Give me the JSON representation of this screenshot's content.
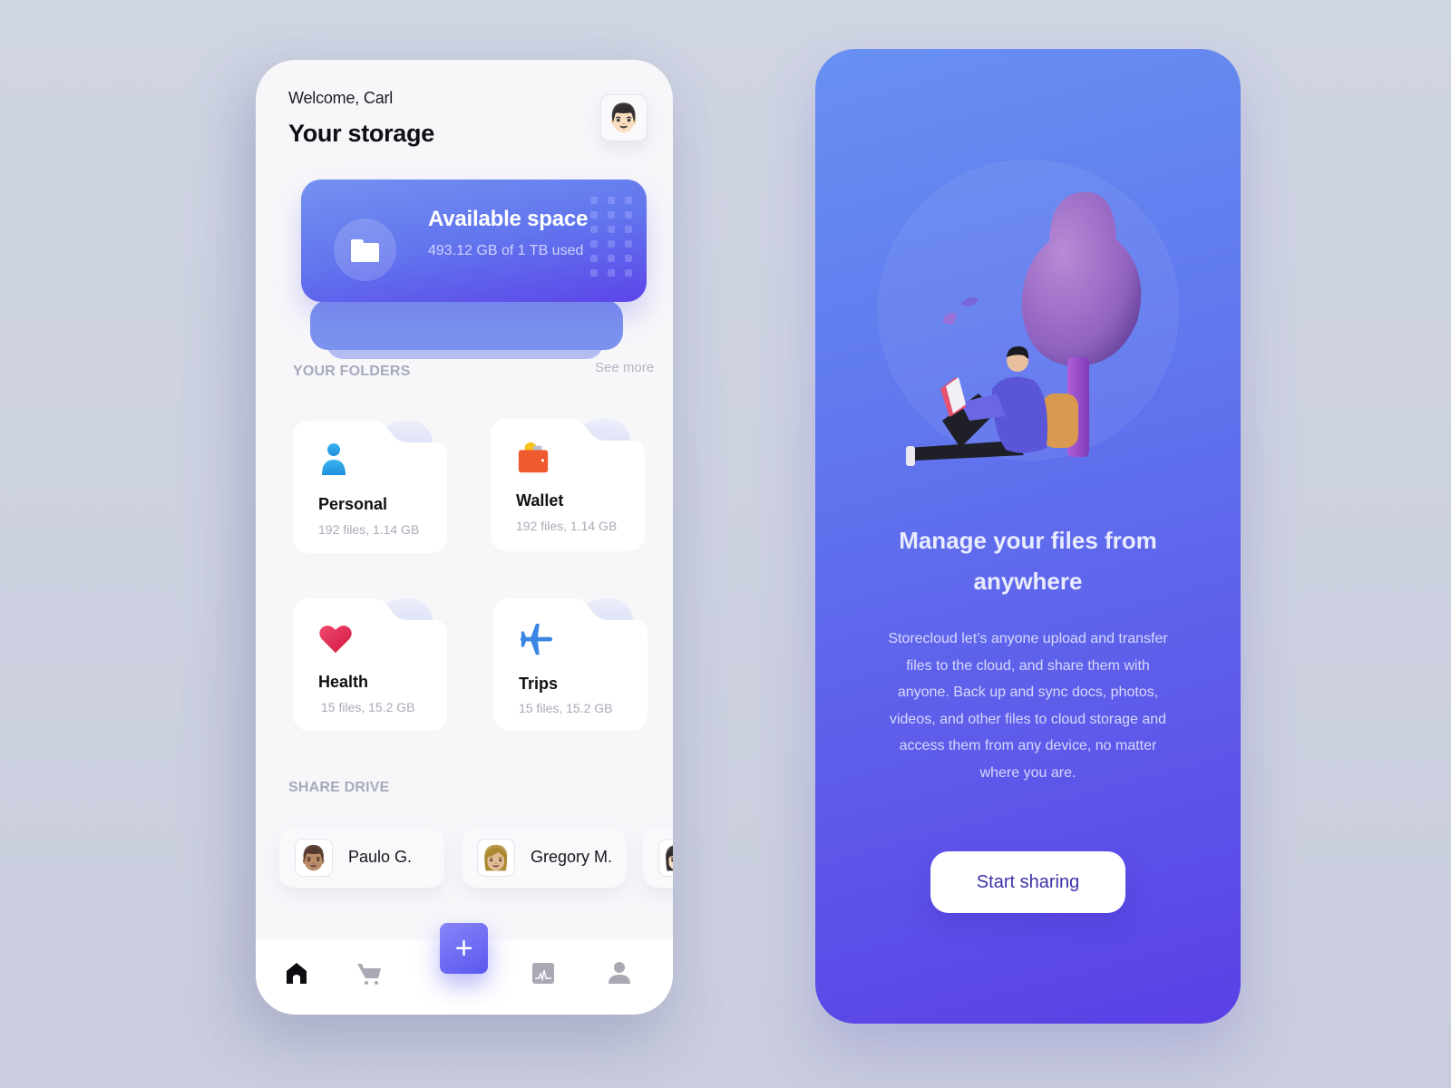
{
  "app": {
    "welcome": "Welcome, Carl",
    "title": "Your storage",
    "user_avatar": "man-mustache-emoji",
    "user_avatar_glyph": "👨🏻"
  },
  "storage": {
    "title": "Available space",
    "usage": "493.12 GB of 1 TB used",
    "used_gb": 493.12,
    "total_tb": 1,
    "icon": "folder-icon"
  },
  "folders": {
    "heading": "YOUR FOLDERS",
    "see_more": "See more",
    "items": [
      {
        "name": "Personal",
        "meta": "192 files, 1.14 GB",
        "icon": "person-icon",
        "color": "#2aa3e6"
      },
      {
        "name": "Wallet",
        "meta": "192 files, 1.14 GB",
        "icon": "wallet-icon",
        "color": "#f0582e"
      },
      {
        "name": "Health",
        "meta": "15 files, 15.2 GB",
        "icon": "heart-icon",
        "color": "#e0264f"
      },
      {
        "name": "Trips",
        "meta": "15 files, 15.2 GB",
        "icon": "airplane-icon",
        "color": "#3a86e4"
      }
    ]
  },
  "share_drive": {
    "heading": "SHARE DRIVE",
    "people": [
      {
        "name": "Paulo G.",
        "avatar": "👨🏽"
      },
      {
        "name": "Gregory M.",
        "avatar": "👩🏼"
      },
      {
        "name": "",
        "avatar": "👩🏻"
      }
    ]
  },
  "nav": {
    "items": [
      "home-icon",
      "cart-icon",
      "add-icon",
      "chart-icon",
      "profile-icon"
    ],
    "active": "home-icon",
    "fab_label": "+"
  },
  "promo": {
    "title": "Manage your files from anywhere",
    "body": "Storecloud let’s anyone upload and transfer files to the cloud, and share them with anyone. Back up and sync docs, photos, videos, and other files to cloud storage and access them from any device, no matter where you are.",
    "cta": "Start sharing"
  },
  "colors": {
    "accent": "#5c45e8",
    "accent_light": "#6890f2",
    "background": "#d0d5e3",
    "card": "#f7f7fa"
  }
}
